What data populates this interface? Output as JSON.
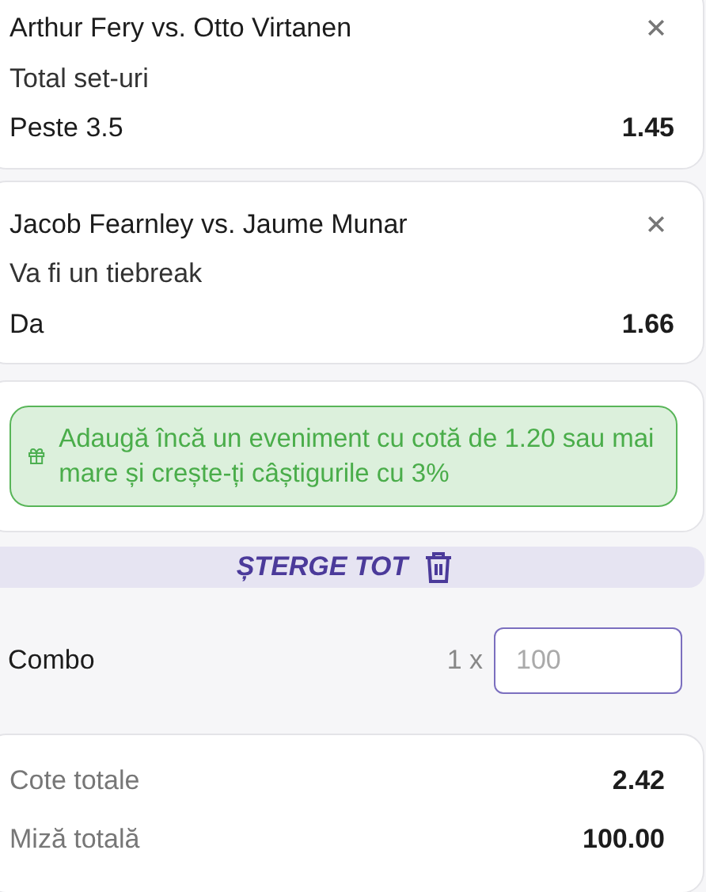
{
  "selections": [
    {
      "match": "Arthur Fery vs. Otto Virtanen",
      "market": "Total set-uri",
      "pick": "Peste 3.5",
      "odds": "1.45"
    },
    {
      "match": "Jacob Fearnley vs. Jaume Munar",
      "market": "Va fi un tiebreak",
      "pick": "Da",
      "odds": "1.66"
    }
  ],
  "promo": {
    "text": "Adaugă încă un eveniment cu cotă de 1.20 sau mai mare și crește-ți câștigurile cu 3%"
  },
  "clear_button": {
    "label": "ȘTERGE TOT"
  },
  "combo": {
    "label": "Combo",
    "multiplier": "1 x",
    "stake_placeholder": "100"
  },
  "summary": [
    {
      "label": "Cote totale",
      "value": "2.42"
    },
    {
      "label": "Miză totală",
      "value": "100.00"
    }
  ]
}
